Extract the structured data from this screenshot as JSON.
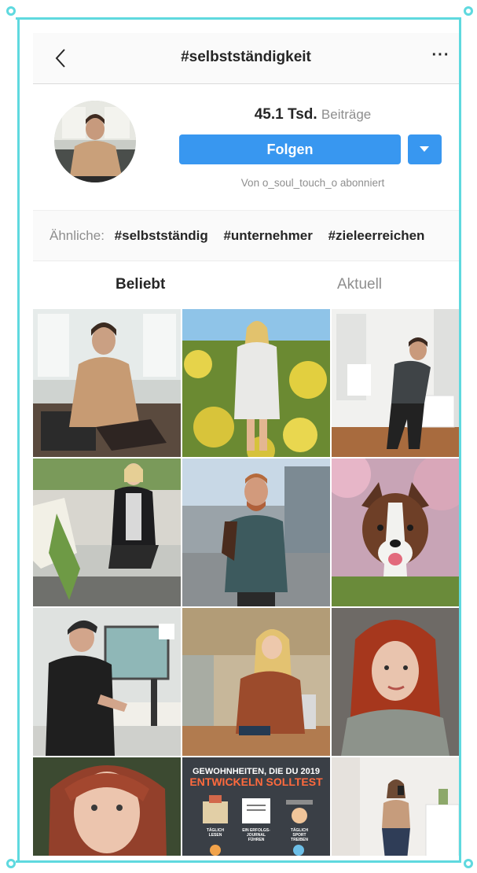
{
  "header": {
    "title": "#selbstständigkeit",
    "back_icon": "chevron-left-icon",
    "more_label": "···"
  },
  "profile": {
    "posts_count": "45.1 Tsd.",
    "posts_label": "Beiträge",
    "follow_label": "Folgen",
    "followed_by": "Von o_soul_touch_o abonniert",
    "dropdown_icon": "caret-down-icon"
  },
  "related": {
    "label": "Ähnliche:",
    "tags": [
      "#selbstständig",
      "#unternehmer",
      "#zieleerreichen"
    ]
  },
  "tabs": {
    "popular": "Beliebt",
    "recent": "Aktuell"
  },
  "promo": {
    "line1": "GEWOHNHEITEN, DIE DU 2019",
    "line2": "ENTWICKELN SOLLTEST",
    "items": [
      "TÄGLICH LESEN",
      "EIN ERFOLGS-JOURNAL FÜHREN",
      "TÄGLICH SPORT TREIBEN"
    ]
  },
  "colors": {
    "accent": "#3897f0",
    "frame": "#5fd9df",
    "text": "#262626",
    "muted": "#8e8e8e"
  }
}
